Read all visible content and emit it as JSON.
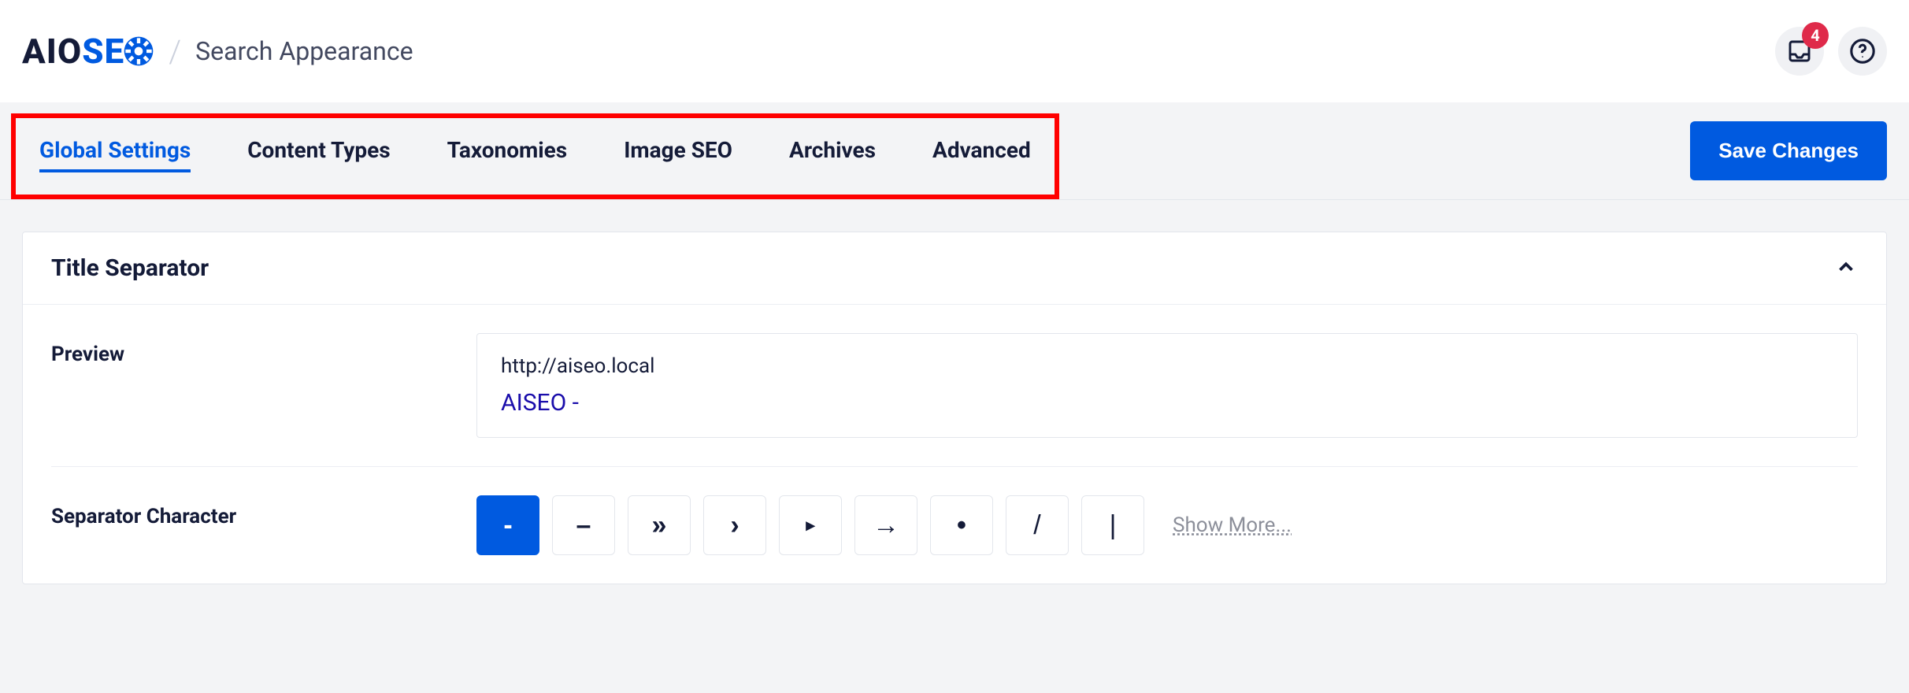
{
  "header": {
    "logo_aio": "AIO",
    "logo_se": "SE",
    "slash": "/",
    "title": "Search Appearance",
    "notif_count": "4"
  },
  "tabs": {
    "items": [
      {
        "label": "Global Settings",
        "active": true
      },
      {
        "label": "Content Types",
        "active": false
      },
      {
        "label": "Taxonomies",
        "active": false
      },
      {
        "label": "Image SEO",
        "active": false
      },
      {
        "label": "Archives",
        "active": false
      },
      {
        "label": "Advanced",
        "active": false
      }
    ],
    "save_label": "Save Changes"
  },
  "card": {
    "title": "Title Separator",
    "preview_label": "Preview",
    "preview_url": "http://aiseo.local",
    "preview_title": "AISEO -",
    "separator_label": "Separator Character",
    "separators": [
      {
        "glyph": "-",
        "selected": true
      },
      {
        "glyph": "–",
        "selected": false
      },
      {
        "glyph": "»",
        "selected": false
      },
      {
        "glyph": "›",
        "selected": false
      },
      {
        "glyph": "▸",
        "selected": false,
        "small": true
      },
      {
        "glyph": "→",
        "selected": false
      },
      {
        "glyph": "•",
        "selected": false
      },
      {
        "glyph": "/",
        "selected": false
      },
      {
        "glyph": "|",
        "selected": false
      }
    ],
    "show_more": "Show More..."
  }
}
